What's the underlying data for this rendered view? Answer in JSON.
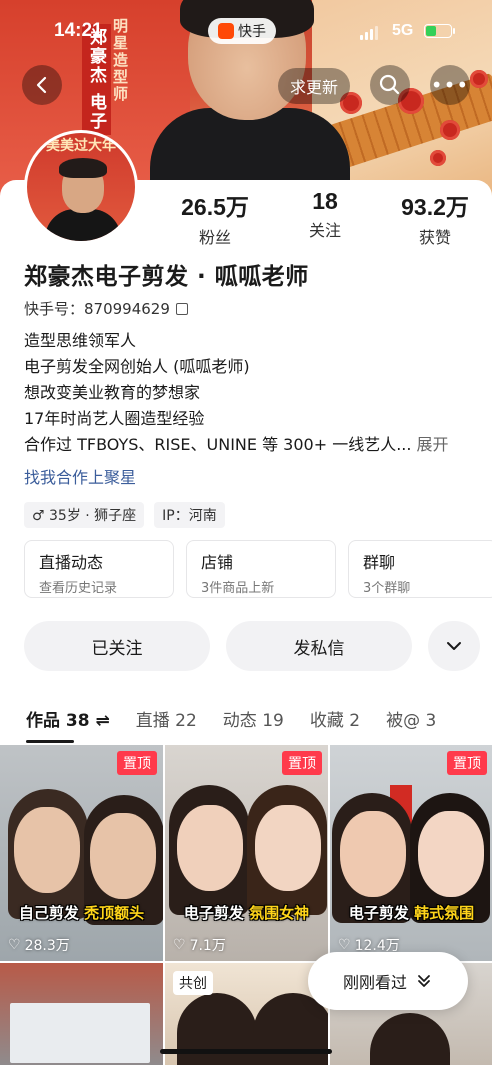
{
  "status_bar": {
    "time": "14:21",
    "app_name": "快手",
    "network": "5G"
  },
  "banner": {
    "vertical_title_main": "郑豪杰 电子",
    "vertical_title_sub": "明星造型师",
    "update_button": "求更新"
  },
  "avatar_text": "美美过大年",
  "stats": [
    {
      "value": "26.5万",
      "label": "粉丝"
    },
    {
      "value": "18",
      "label": "关注"
    },
    {
      "value": "93.2万",
      "label": "获赞"
    }
  ],
  "profile": {
    "name": "郑豪杰电子剪发 · 呱呱老师",
    "kuaishou_id": "快手号：870994629",
    "bio": [
      "造型思维领军人",
      "电子剪发全网创始人 (呱呱老师)",
      "想改变美业教育的梦想家",
      "17年时尚艺人圈造型经验",
      "合作过 TFBOYS、RISE、UNINE 等 300+ 一线艺人..."
    ],
    "expand_label": "展开",
    "coop_link": "找我合作上聚星",
    "tags": [
      "♂ 35岁 · 狮子座",
      "IP：河南"
    ]
  },
  "tiles": [
    {
      "title": "直播动态",
      "sub": "查看历史记录"
    },
    {
      "title": "店铺",
      "sub": "3件商品上新"
    },
    {
      "title": "群聊",
      "sub": "3个群聊"
    }
  ],
  "actions": {
    "follow": "已关注",
    "message": "发私信"
  },
  "tabs": [
    {
      "label": "作品 38 ⇌",
      "active": true
    },
    {
      "label": "直播 22",
      "active": false
    },
    {
      "label": "动态 19",
      "active": false
    },
    {
      "label": "收藏 2",
      "active": false
    },
    {
      "label": "被@ 3",
      "active": false
    }
  ],
  "videos": [
    {
      "pinned": "置顶",
      "caption_white": "自己剪发",
      "caption_yellow": "秃顶额头",
      "likes": "28.3万"
    },
    {
      "pinned": "置顶",
      "caption_white": "电子剪发",
      "caption_yellow": "氛围女神",
      "likes": "7.1万"
    },
    {
      "pinned": "置顶",
      "caption_white": "电子剪发",
      "caption_yellow": "韩式氛围",
      "likes": "12.4万"
    }
  ],
  "videos_row2": [
    {
      "badge": ""
    },
    {
      "badge": "共创"
    },
    {
      "badge": ""
    }
  ],
  "recent_button": "刚刚看过",
  "colors": {
    "accent_red": "#ff3a4b",
    "link_blue": "#3b5d9b",
    "caption_yellow": "#ffd51a"
  }
}
